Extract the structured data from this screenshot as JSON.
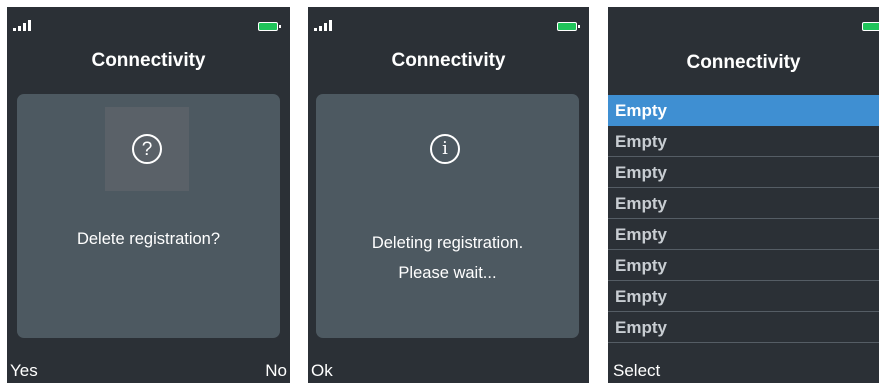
{
  "colors": {
    "screen_bg": "#2b3036",
    "dialog_bg": "#4d5961",
    "selection": "#3f8fd2",
    "battery": "#1fc45a"
  },
  "screen1": {
    "title": "Connectivity",
    "icon": "question-circle-icon",
    "icon_glyph": "?",
    "message": "Delete registration?",
    "softkey_left": "Yes",
    "softkey_right": "No"
  },
  "screen2": {
    "title": "Connectivity",
    "icon": "info-circle-icon",
    "icon_glyph": "i",
    "message_line1": "Deleting registration.",
    "message_line2": "Please wait...",
    "softkey_left": "Ok"
  },
  "screen3": {
    "title": "Connectivity",
    "list": [
      "Empty",
      "Empty",
      "Empty",
      "Empty",
      "Empty",
      "Empty",
      "Empty",
      "Empty"
    ],
    "selected_index": 0,
    "softkey_left": "Select"
  }
}
